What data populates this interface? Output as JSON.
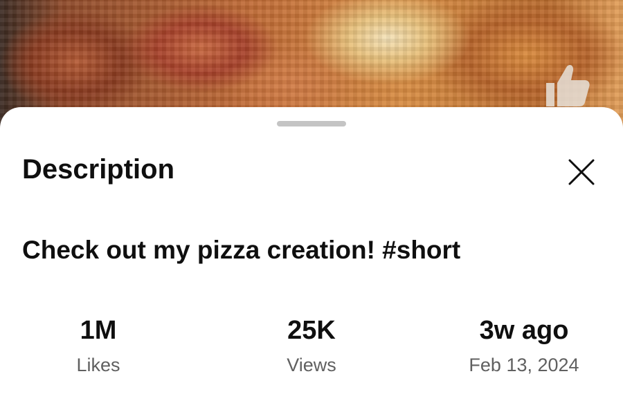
{
  "description_sheet": {
    "title": "Description",
    "close_icon": "close-icon",
    "video_title": "Check out my pizza creation! #short",
    "stats": {
      "likes": {
        "value": "1M",
        "label": "Likes"
      },
      "views": {
        "value": "25K",
        "label": "Views"
      },
      "date": {
        "value": "3w ago",
        "label": "Feb 13, 2024"
      }
    }
  },
  "overlay_icons": {
    "like": "thumbs-up-icon"
  },
  "colors": {
    "sheet_background": "#ffffff",
    "primary_text": "#0f0f0f",
    "secondary_text": "#606060",
    "handle": "#c4c4c4"
  }
}
